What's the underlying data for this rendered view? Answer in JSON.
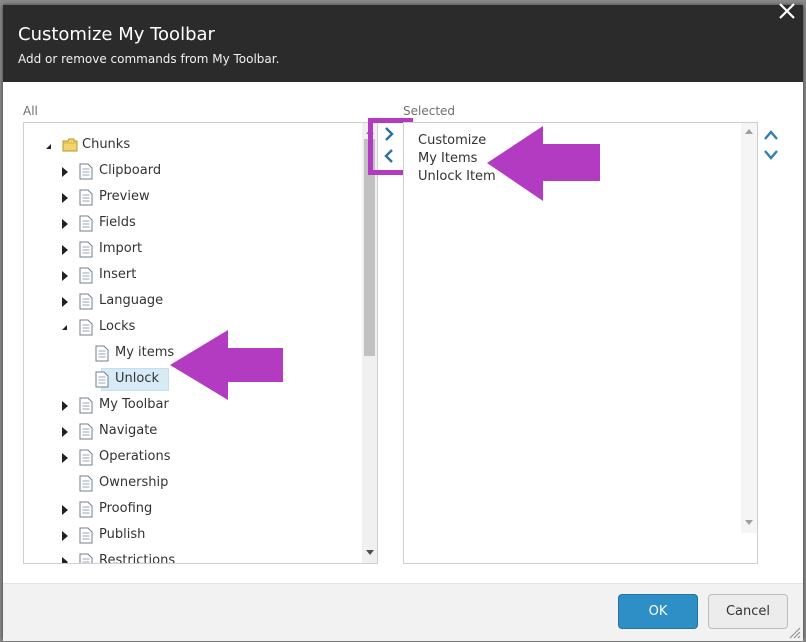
{
  "dialog": {
    "title": "Customize My Toolbar",
    "subtitle": "Add or remove commands from My Toolbar."
  },
  "all_panel": {
    "label": "All",
    "root": {
      "label": "Chunks",
      "icon": "folder-icon",
      "state": "expanded"
    },
    "items": [
      {
        "label": "Clipboard",
        "state": "collapsed"
      },
      {
        "label": "Preview",
        "state": "collapsed"
      },
      {
        "label": "Fields",
        "state": "collapsed"
      },
      {
        "label": "Import",
        "state": "collapsed"
      },
      {
        "label": "Insert",
        "state": "collapsed"
      },
      {
        "label": "Language",
        "state": "collapsed"
      },
      {
        "label": "Locks",
        "state": "expanded"
      },
      {
        "label": "My items",
        "state": "leaf"
      },
      {
        "label": "Unlock",
        "state": "selected"
      },
      {
        "label": "My Toolbar",
        "state": "collapsed"
      },
      {
        "label": "Navigate",
        "state": "collapsed"
      },
      {
        "label": "Operations",
        "state": "collapsed"
      },
      {
        "label": "Ownership",
        "state": "leaf"
      },
      {
        "label": "Proofing",
        "state": "collapsed"
      },
      {
        "label": "Publish",
        "state": "collapsed"
      },
      {
        "label": "Restrictions",
        "state": "collapsed"
      }
    ]
  },
  "selected_panel": {
    "label": "Selected",
    "items": [
      "Customize",
      "My Items",
      "Unlock Item"
    ]
  },
  "buttons": {
    "ok": "OK",
    "cancel": "Cancel"
  },
  "colors": {
    "header": "#2b2b2b",
    "accent": "#2e8fc6",
    "highlight": "#b23bc1",
    "selection": "#d7ebf7"
  }
}
